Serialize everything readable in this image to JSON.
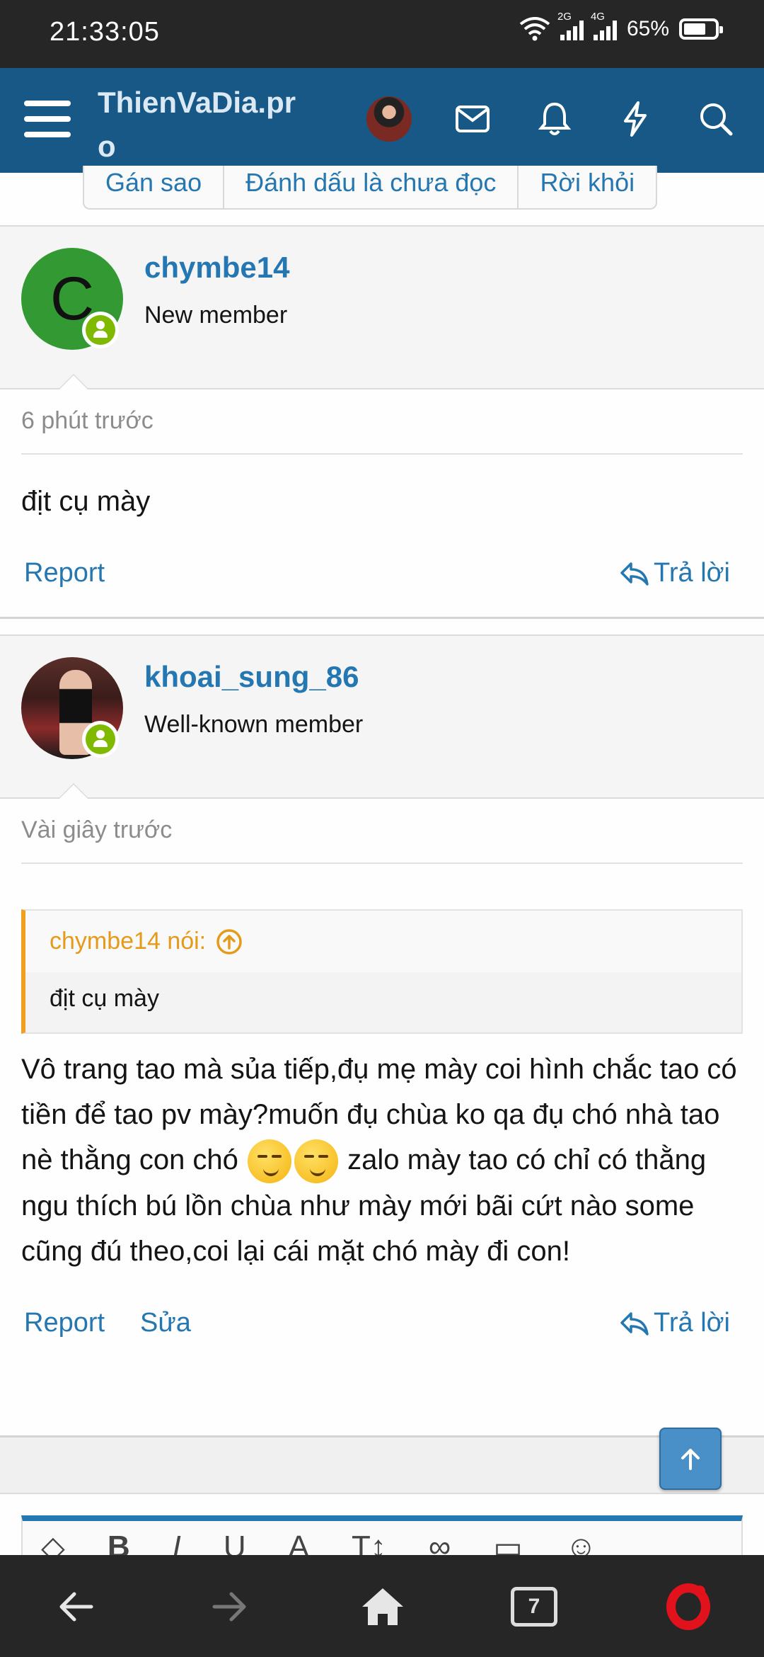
{
  "status_bar": {
    "time": "21:33:05",
    "net1": "2G",
    "net2": "4G",
    "battery": "65%"
  },
  "header": {
    "site_title": "ThienVaDia.pro"
  },
  "thread_buttons": [
    "Gán sao",
    "Đánh dấu là chưa đọc",
    "Rời khỏi"
  ],
  "posts": [
    {
      "avatar_letter": "C",
      "username": "chymbe14",
      "user_title": "New member",
      "time": "6 phút trước",
      "message": "địt cụ mày",
      "report": "Report",
      "reply": "Trả lời"
    },
    {
      "username": "khoai_sung_86",
      "user_title": "Well-known member",
      "time": "Vài giây trước",
      "quote_author": "chymbe14 nói:",
      "quote_text": "địt cụ mày",
      "message_part1": "Vô trang tao mà sủa tiếp,đụ mẹ mày coi hình chắc tao có tiền để tao pv mày?muốn đụ chùa ko qa đụ chó nhà tao nè thằng con chó",
      "message_part2": "zalo mày tao có chỉ có thằng ngu thích bú lồn chùa như mày mới bãi cứt nào some cũng đú theo,coi lại cái mặt chó mày đi con!",
      "emojis": [
        "smirking-face",
        "smirking-face"
      ],
      "report": "Report",
      "edit": "Sửa",
      "reply": "Trả lời"
    }
  ],
  "editor_tools": [
    "B",
    "I",
    "U",
    "A",
    "T↕"
  ],
  "nav": {
    "tab_count": "7"
  },
  "colors": {
    "header_bg": "#185886",
    "link": "#2577b1",
    "quote_accent": "#f0a020",
    "online": "#7fb900",
    "opera": "#e1121b"
  }
}
